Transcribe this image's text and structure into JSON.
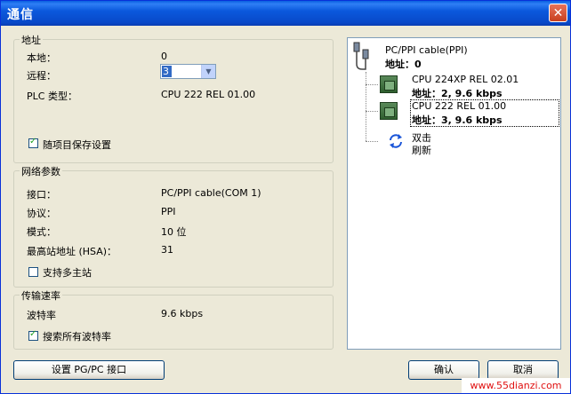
{
  "window": {
    "title": "通信",
    "close_glyph": "✕"
  },
  "address_group": {
    "legend": "地址",
    "local_label": "本地：",
    "local_value": "0",
    "remote_label": "远程：",
    "remote_value": "3",
    "plc_type_label": "PLC 类型：",
    "plc_type_value": "CPU 222 REL 01.00",
    "save_with_project_label": "随项目保存设置",
    "save_with_project_checked": true
  },
  "network_group": {
    "legend": "网络参数",
    "interface_label": "接口：",
    "interface_value": "PC/PPI cable(COM 1)",
    "protocol_label": "协议：",
    "protocol_value": "PPI",
    "mode_label": "模式：",
    "mode_value": "10 位",
    "hsa_label": "最高站地址 (HSA)：",
    "hsa_value": "31",
    "multi_master_label": "支持多主站",
    "multi_master_checked": false
  },
  "baud_group": {
    "legend": "传输速率",
    "baud_label": "波特率",
    "baud_value": "9.6 kbps",
    "search_all_label": "搜索所有波特率",
    "search_all_checked": true
  },
  "buttons": {
    "set_pgpc": "设置 PG/PC 接口",
    "ok": "确认",
    "cancel": "取消"
  },
  "tree": {
    "root": {
      "name": "PC/PPI cable(PPI)",
      "address": "地址：0",
      "icon": "cable-icon"
    },
    "devices": [
      {
        "name": "CPU 224XP REL 02.01",
        "address": "地址：2, 9.6 kbps",
        "icon": "plc-icon"
      },
      {
        "name": "CPU 222 REL 01.00",
        "address": "地址：3, 9.6 kbps",
        "icon": "plc-icon",
        "selected": true
      }
    ],
    "refresh": {
      "line1": "双击",
      "line2": "刷新",
      "icon": "refresh-icon"
    }
  },
  "watermark": "www.55dianzi.com"
}
